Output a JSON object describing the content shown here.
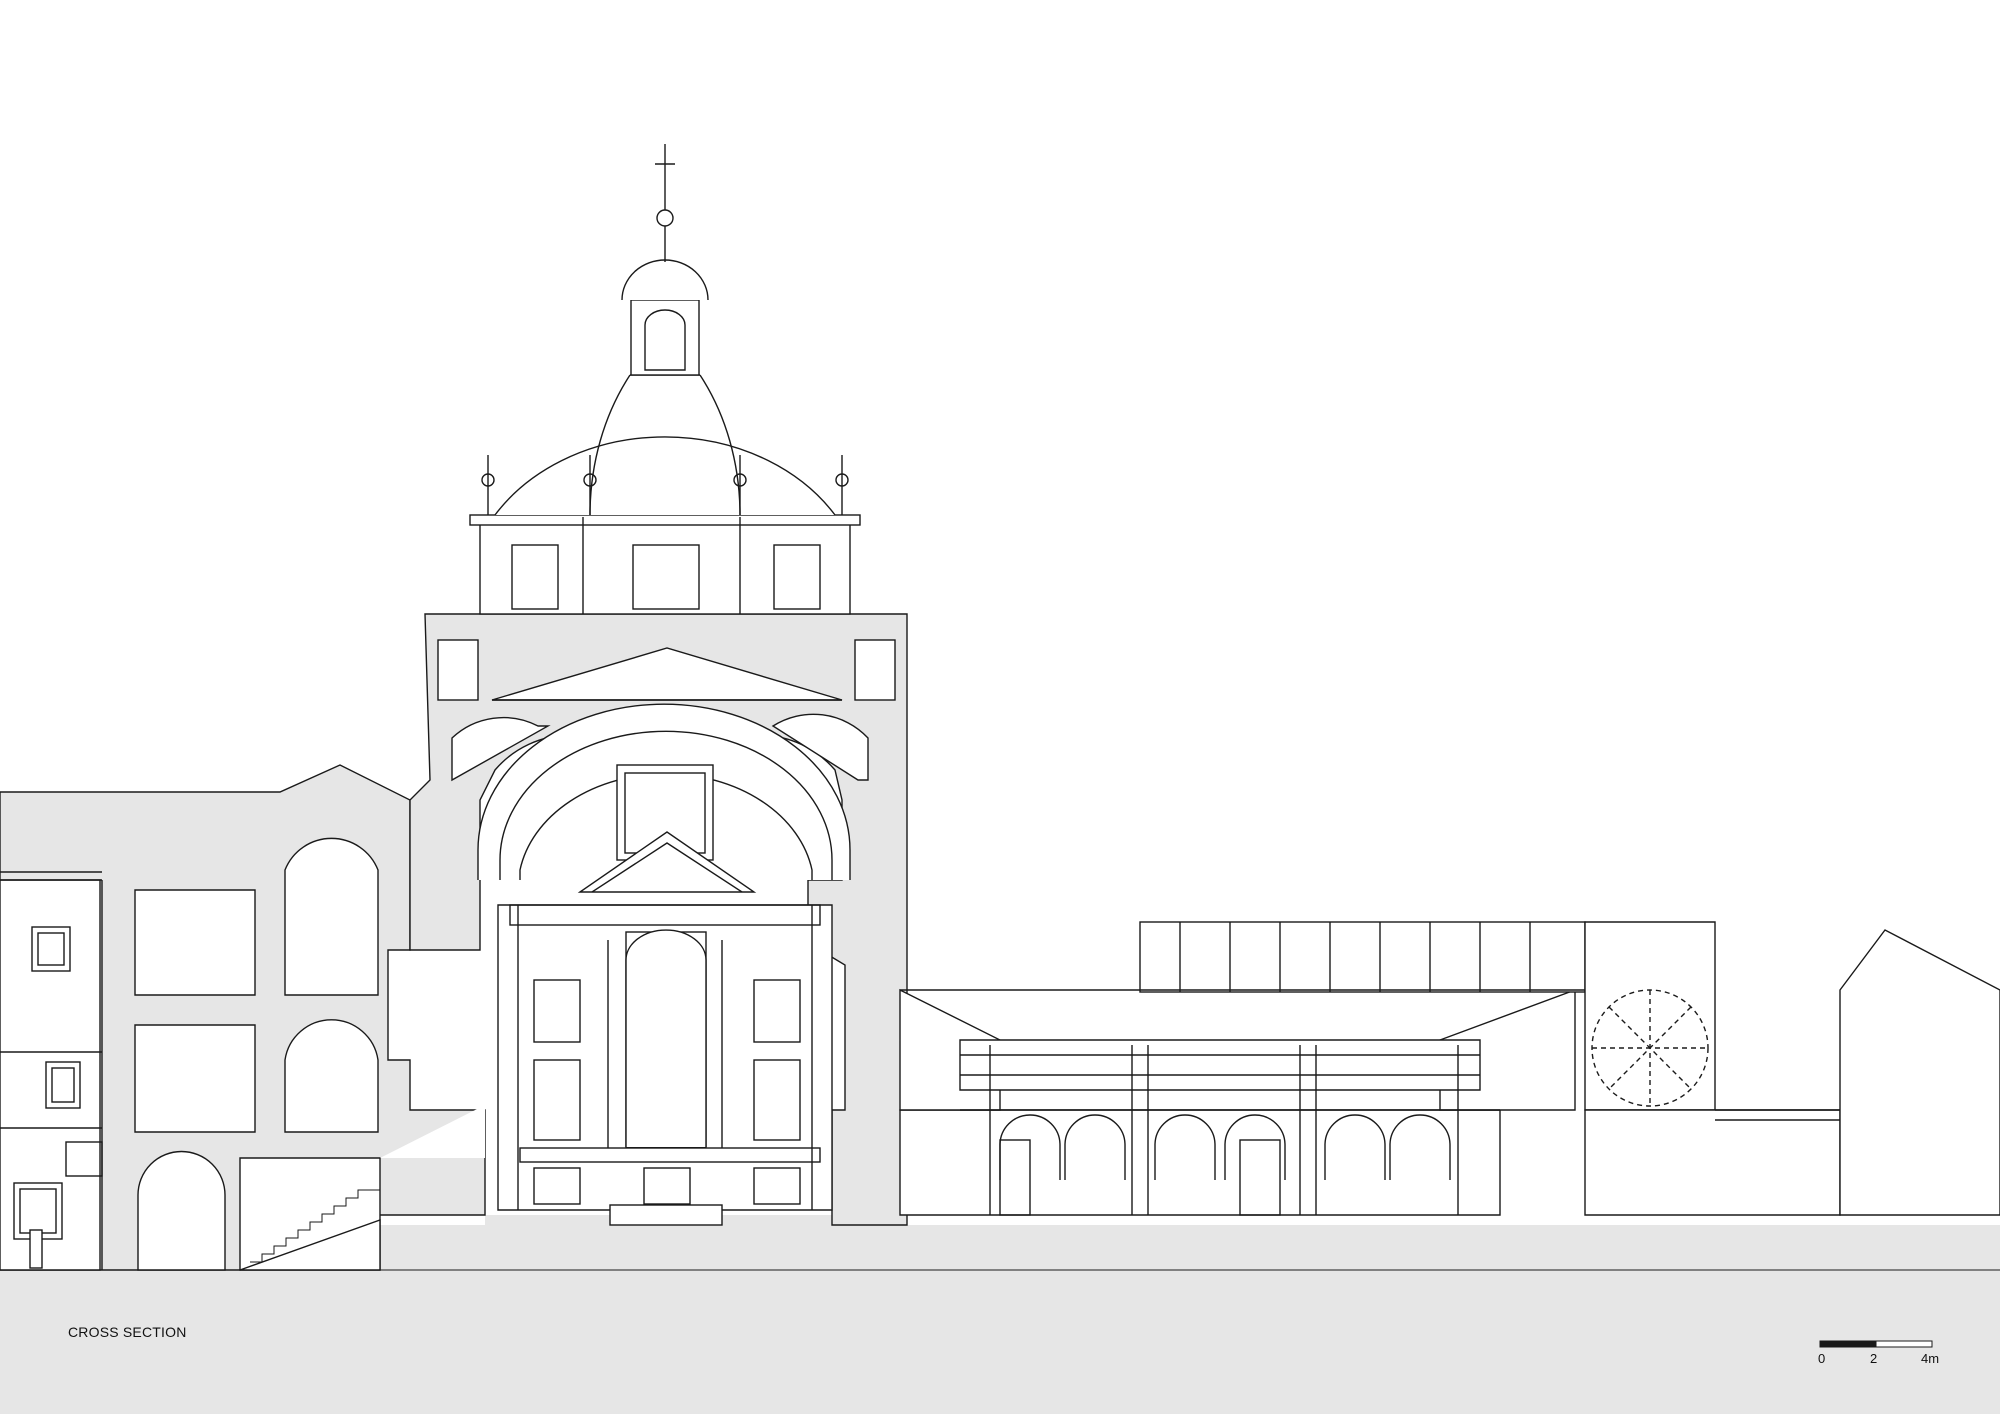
{
  "drawing": {
    "title": "CROSS SECTION",
    "scale_bar": {
      "ticks": [
        "0",
        "2",
        "4m"
      ],
      "segments": 2
    }
  },
  "colors": {
    "ink": "#1a1a1a",
    "section_fill": "#e6e6e6",
    "background": "#ffffff"
  }
}
